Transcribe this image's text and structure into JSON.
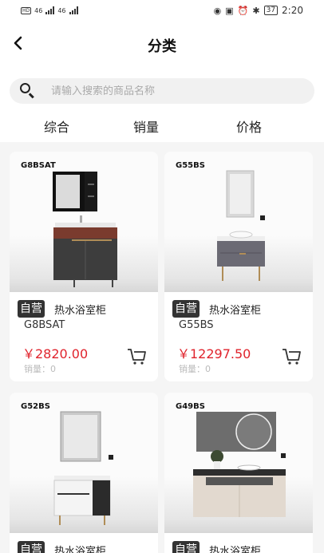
{
  "status": {
    "left_hd": "HD",
    "left_net": "46",
    "time": "2:20",
    "battery": "37"
  },
  "header": {
    "back_label": "‹",
    "title": "分类"
  },
  "search": {
    "placeholder": "请输入搜索的商品名称"
  },
  "sort_tabs": [
    "综合",
    "销量",
    "价格"
  ],
  "products": [
    {
      "code": "G8BSAT",
      "badge": "自营",
      "name": "热水浴室柜",
      "model": "G8BSAT",
      "price": "￥2820.00",
      "sales": "销量：0"
    },
    {
      "code": "G55BS",
      "badge": "自营",
      "name": "热水浴室柜",
      "model": "G55BS",
      "price": "￥12297.50",
      "sales": "销量：0"
    },
    {
      "code": "G52BS",
      "badge": "自营",
      "name": "热水浴室柜",
      "model": "",
      "price": "",
      "sales": ""
    },
    {
      "code": "G49BS",
      "badge": "自营",
      "name": "热水浴室柜",
      "model": "",
      "price": "",
      "sales": ""
    }
  ],
  "colors": {
    "accent_price": "#e0232c",
    "badge_bg": "#333333",
    "page_bg": "#f5f5f5"
  },
  "icons": {
    "back": "chevron-left-icon",
    "search": "search-icon",
    "cart": "cart-icon"
  }
}
